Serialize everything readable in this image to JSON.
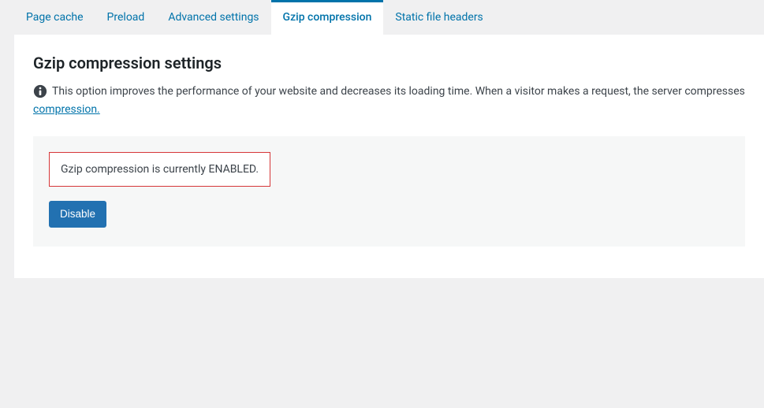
{
  "tabs": [
    {
      "label": "Page cache"
    },
    {
      "label": "Preload"
    },
    {
      "label": "Advanced settings"
    },
    {
      "label": "Gzip compression"
    },
    {
      "label": "Static file headers"
    }
  ],
  "page": {
    "title": "Gzip compression settings",
    "info_text": "This option improves the performance of your website and decreases its loading time. When a visitor makes a request, the server compresses the requested re",
    "info_link_text": "compression."
  },
  "status": {
    "message": "Gzip compression is currently ENABLED.",
    "button_label": "Disable"
  }
}
